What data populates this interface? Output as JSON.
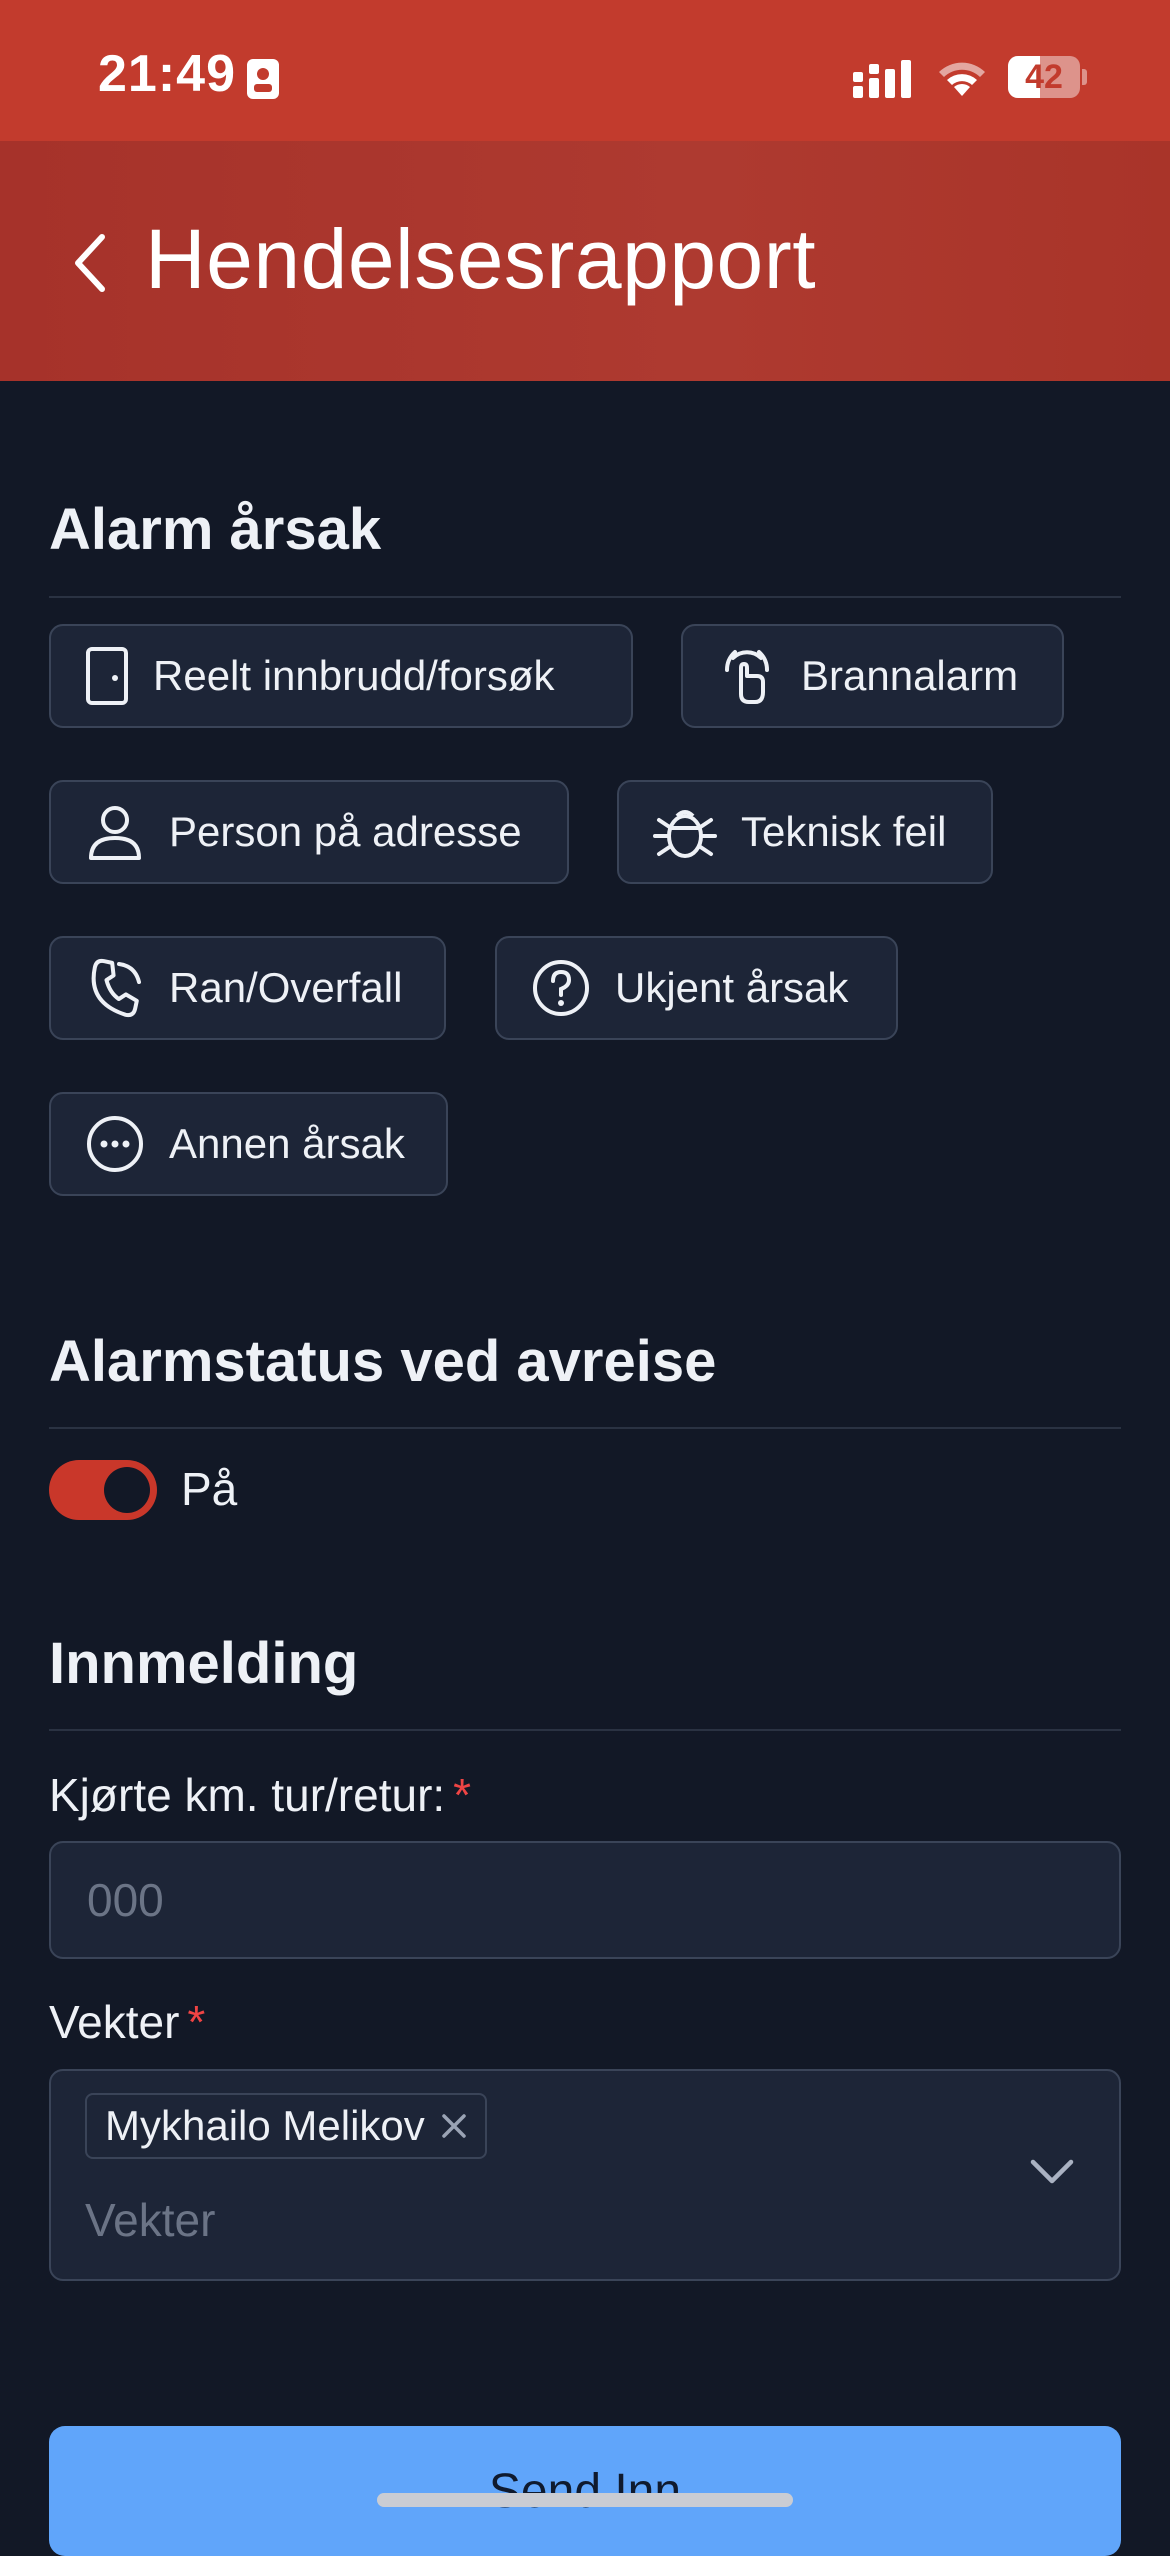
{
  "status_bar": {
    "time": "21:49",
    "battery": "42"
  },
  "header": {
    "title": "Hendelsesrapport"
  },
  "alarm_cause": {
    "title": "Alarm årsak",
    "options": [
      {
        "label": "Reelt innbrudd/forsøk",
        "icon": "door-icon"
      },
      {
        "label": "Brannalarm",
        "icon": "fire-alarm-icon"
      },
      {
        "label": "Person på adresse",
        "icon": "person-icon"
      },
      {
        "label": "Teknisk feil",
        "icon": "bug-icon"
      },
      {
        "label": "Ran/Overfall",
        "icon": "phone-icon"
      },
      {
        "label": "Ukjent årsak",
        "icon": "question-icon"
      },
      {
        "label": "Annen årsak",
        "icon": "more-icon"
      }
    ]
  },
  "alarm_status": {
    "title": "Alarmstatus ved avreise",
    "toggle_label": "På",
    "toggle_on": true
  },
  "registration": {
    "title": "Innmelding",
    "km_label": "Kjørte km. tur/retur:",
    "km_placeholder": "000",
    "guard_label": "Vekter",
    "guard_selected": "Mykhailo Melikov",
    "guard_placeholder": "Vekter",
    "required_marker": "*"
  },
  "submit_label": "Send Inn",
  "colors": {
    "accent": "#c23b2d",
    "background": "#121826",
    "button": "#60a5fa"
  }
}
